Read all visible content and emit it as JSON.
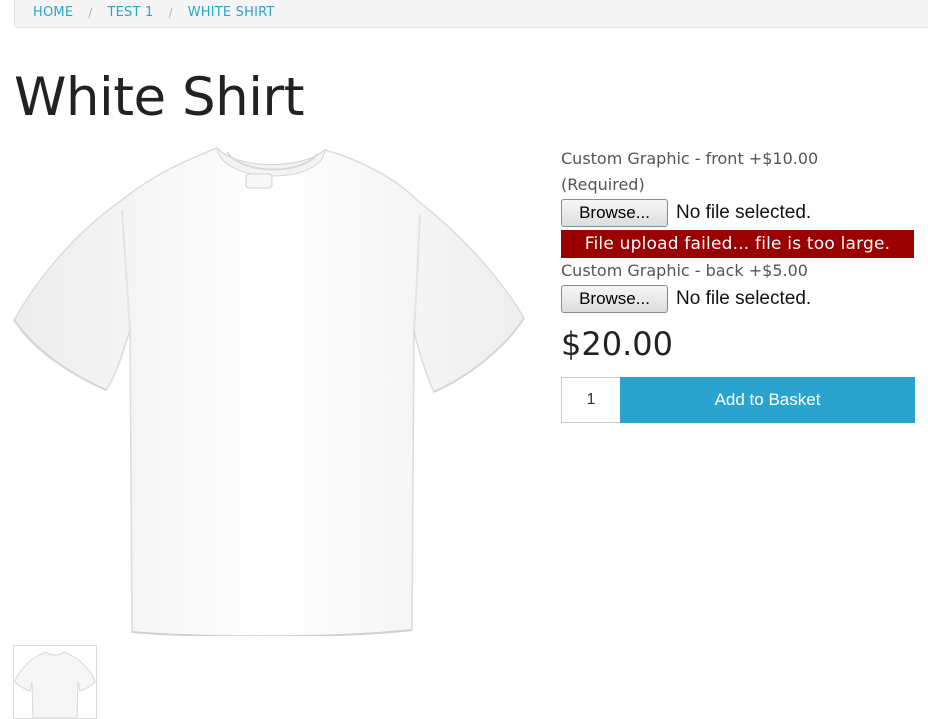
{
  "breadcrumb": {
    "items": [
      "HOME",
      "TEST 1",
      "WHITE SHIRT"
    ],
    "separator": "/"
  },
  "product": {
    "title": "White Shirt",
    "price": "$20.00",
    "image_icon": "white-tshirt-image",
    "thumbnail_icon": "white-tshirt-thumbnail"
  },
  "options": {
    "front": {
      "label": "Custom Graphic - front +$10.00",
      "required_note": "(Required)",
      "button": "Browse...",
      "status": "No file selected.",
      "error": "File upload failed... file is too large."
    },
    "back": {
      "label": "Custom Graphic - back +$5.00",
      "button": "Browse...",
      "status": "No file selected."
    }
  },
  "purchase": {
    "quantity": "1",
    "add_button": "Add to Basket"
  },
  "colors": {
    "link": "#2aa4cf",
    "error_bg": "#9b0000",
    "button_bg": "#2aa4cf"
  }
}
